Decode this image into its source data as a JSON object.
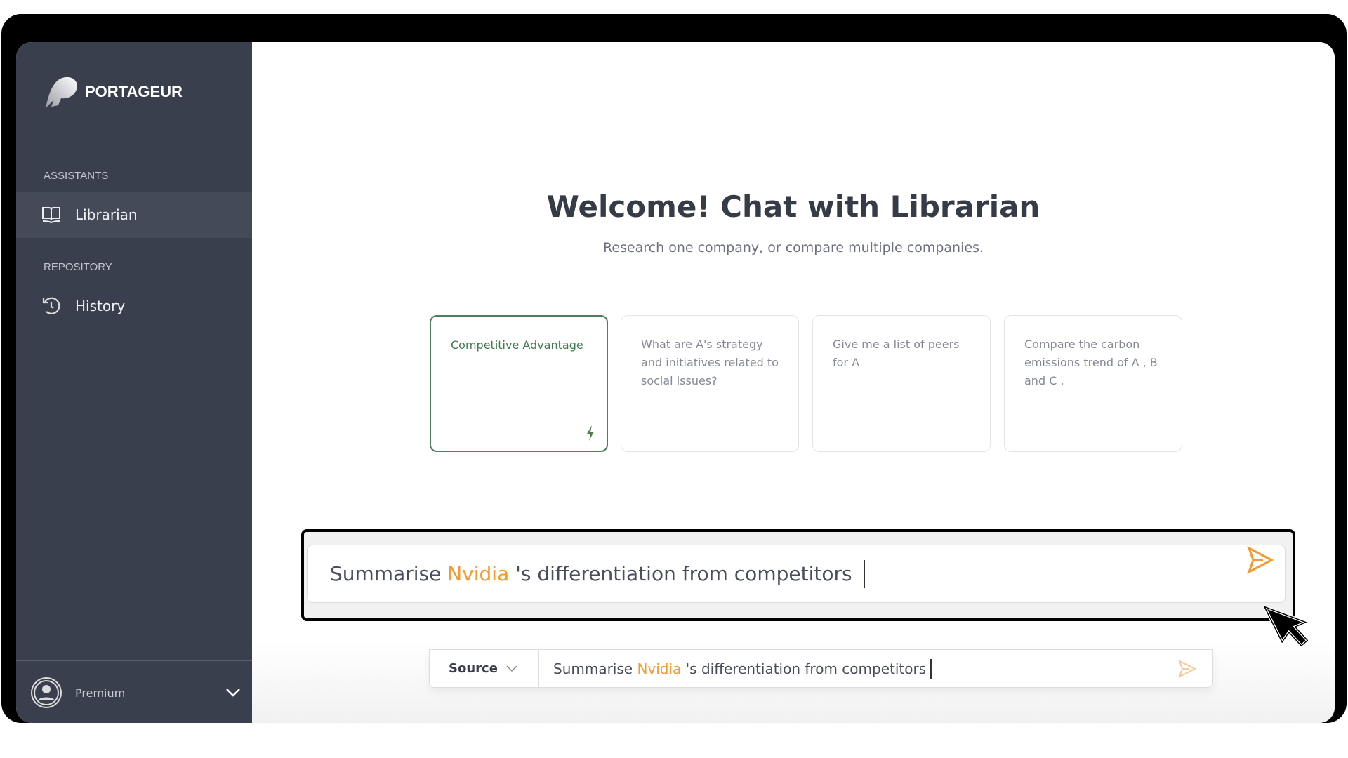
{
  "brand": {
    "name": "PORTAGEUR"
  },
  "sidebar": {
    "sections": [
      {
        "label": "ASSISTANTS",
        "items": [
          {
            "label": "Librarian",
            "icon": "book-icon",
            "active": true
          }
        ]
      },
      {
        "label": "REPOSITORY",
        "items": [
          {
            "label": "History",
            "icon": "history-icon",
            "active": false
          }
        ]
      }
    ],
    "user": {
      "plan": "Premium"
    }
  },
  "main": {
    "title": "Welcome! Chat with Librarian",
    "subtitle": "Research one company, or compare multiple companies.",
    "cards": [
      {
        "text": "Competitive Advantage",
        "selected": true
      },
      {
        "text": "What are A's strategy and initiatives related to social issues?"
      },
      {
        "text": "Give me a list of peers for A"
      },
      {
        "text": "Compare the carbon emissions trend of A , B and C ."
      }
    ]
  },
  "input": {
    "prefix": "Summarise ",
    "entity": "Nvidia",
    "suffix": " 's differentiation from competitors",
    "source_label": "Source"
  },
  "colors": {
    "sidebar": "#3a3f4d",
    "accent": "#f59a2f",
    "selected": "#4d7f5a"
  }
}
